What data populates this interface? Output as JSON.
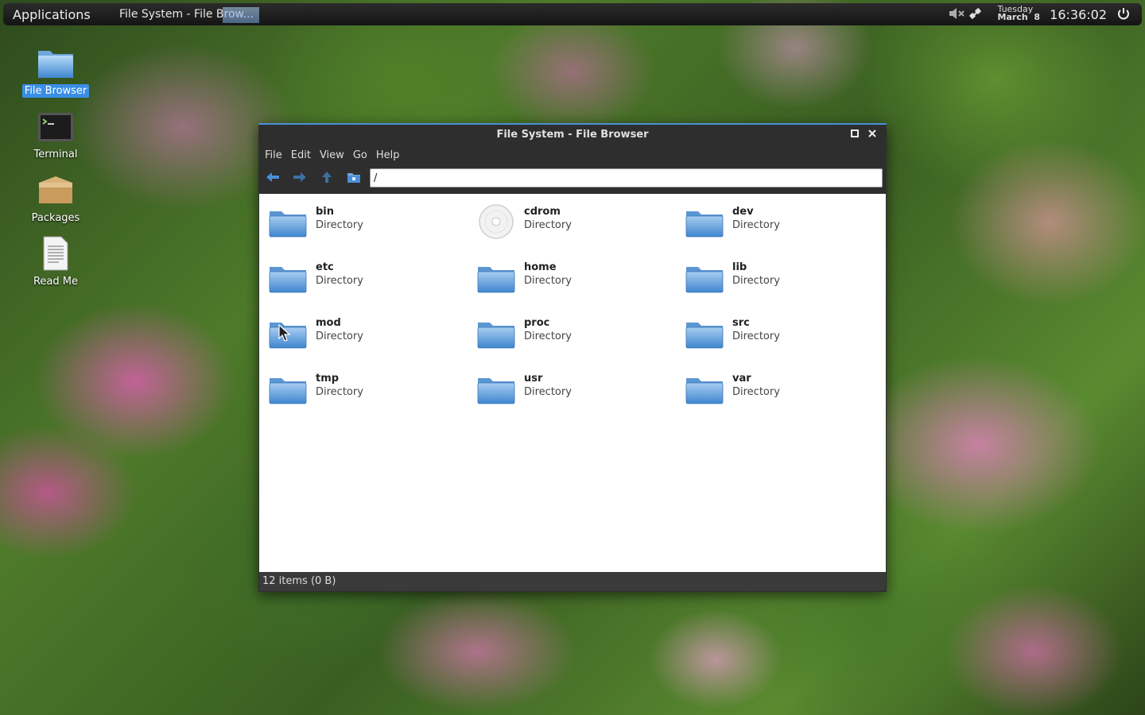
{
  "panel": {
    "applications_label": "Applications",
    "taskbar_item": "File System - File Brow...",
    "date_day": "Tuesday",
    "date_month": "March",
    "date_num": "8",
    "clock": "16:36:02"
  },
  "desktop": {
    "icons": [
      {
        "label": "File Browser"
      },
      {
        "label": "Terminal"
      },
      {
        "label": "Packages"
      },
      {
        "label": "Read Me"
      }
    ]
  },
  "window": {
    "title": "File System - File Browser",
    "menu": [
      "File",
      "Edit",
      "View",
      "Go",
      "Help"
    ],
    "path": "/",
    "items": [
      {
        "name": "bin",
        "kind": "Directory",
        "icon": "folder-icon"
      },
      {
        "name": "cdrom",
        "kind": "Directory",
        "icon": "cdrom-icon"
      },
      {
        "name": "dev",
        "kind": "Directory",
        "icon": "folder-icon"
      },
      {
        "name": "etc",
        "kind": "Directory",
        "icon": "folder-icon"
      },
      {
        "name": "home",
        "kind": "Directory",
        "icon": "folder-icon"
      },
      {
        "name": "lib",
        "kind": "Directory",
        "icon": "folder-icon"
      },
      {
        "name": "mod",
        "kind": "Directory",
        "icon": "folder-icon"
      },
      {
        "name": "proc",
        "kind": "Directory",
        "icon": "folder-icon"
      },
      {
        "name": "src",
        "kind": "Directory",
        "icon": "folder-icon"
      },
      {
        "name": "tmp",
        "kind": "Directory",
        "icon": "folder-icon"
      },
      {
        "name": "usr",
        "kind": "Directory",
        "icon": "folder-icon"
      },
      {
        "name": "var",
        "kind": "Directory",
        "icon": "folder-icon"
      }
    ],
    "status": "12 items (0 B)"
  },
  "colors": {
    "accent": "#3a8ee6",
    "folder_light": "#a9cdf2",
    "folder_dark": "#3f86cf"
  }
}
